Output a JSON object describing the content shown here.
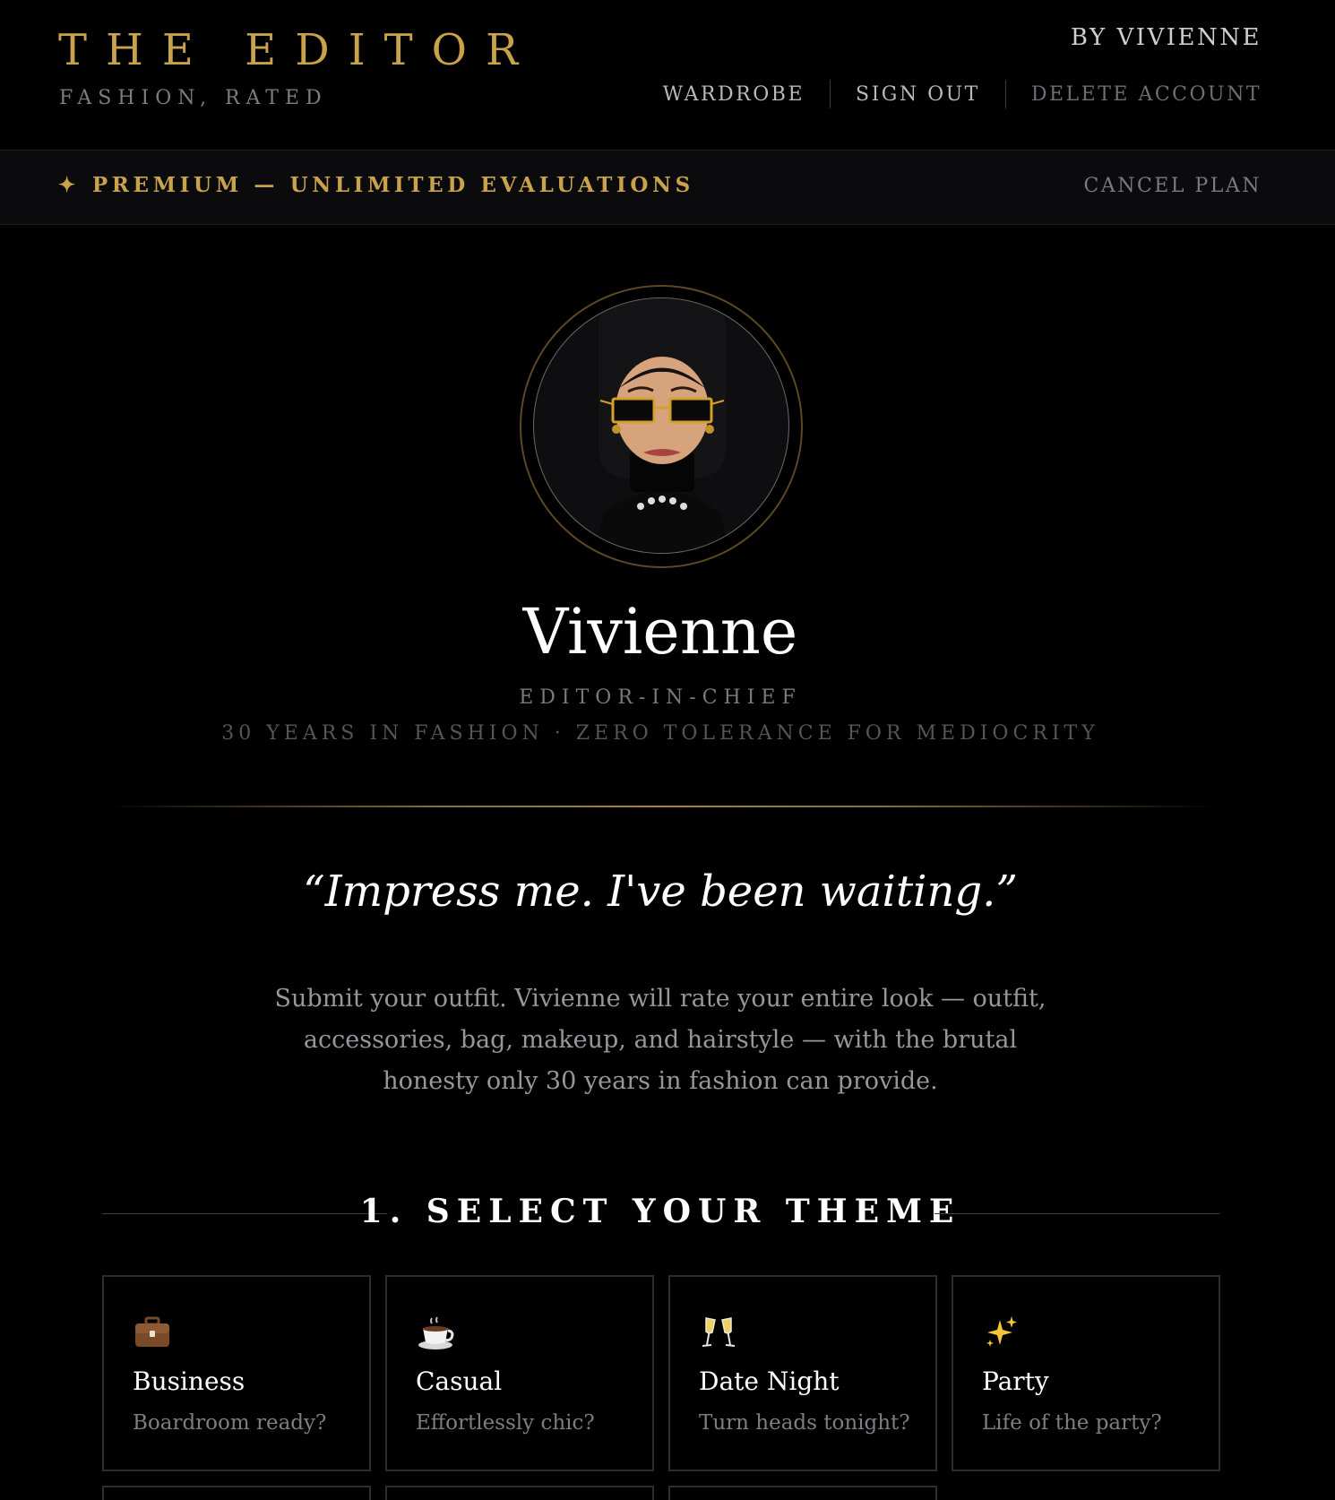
{
  "header": {
    "title": "THE EDITOR",
    "tagline": "FASHION, RATED",
    "byline": "BY VIVIENNE",
    "nav": {
      "wardrobe": "WARDROBE",
      "sign_out": "SIGN OUT",
      "delete_account": "DELETE ACCOUNT"
    }
  },
  "premium": {
    "star": "✦",
    "label": "PREMIUM — UNLIMITED EVALUATIONS",
    "cancel": "CANCEL PLAN"
  },
  "profile": {
    "name": "Vivienne",
    "role": "EDITOR-IN-CHIEF",
    "bio": "30 YEARS IN FASHION · ZERO TOLERANCE FOR MEDIOCRITY"
  },
  "quote": "“Impress me. I've been waiting.”",
  "intro": "Submit your outfit. Vivienne will rate your entire look — outfit, accessories, bag, makeup, and hairstyle — with the brutal honesty only 30 years in fashion can provide.",
  "section": {
    "title": "1. SELECT YOUR THEME"
  },
  "themes": [
    {
      "icon": "briefcase-icon",
      "name": "Business",
      "subtitle": "Boardroom ready?"
    },
    {
      "icon": "coffee-cup-icon",
      "name": "Casual",
      "subtitle": "Effortlessly chic?"
    },
    {
      "icon": "champagne-glasses-icon",
      "name": "Date Night",
      "subtitle": "Turn heads tonight?"
    },
    {
      "icon": "sparkles-icon",
      "name": "Party",
      "subtitle": "Life of the party?"
    }
  ],
  "colors": {
    "accent_gold": "#c9a24c",
    "background": "#000000",
    "text_muted": "#7d7d80"
  }
}
